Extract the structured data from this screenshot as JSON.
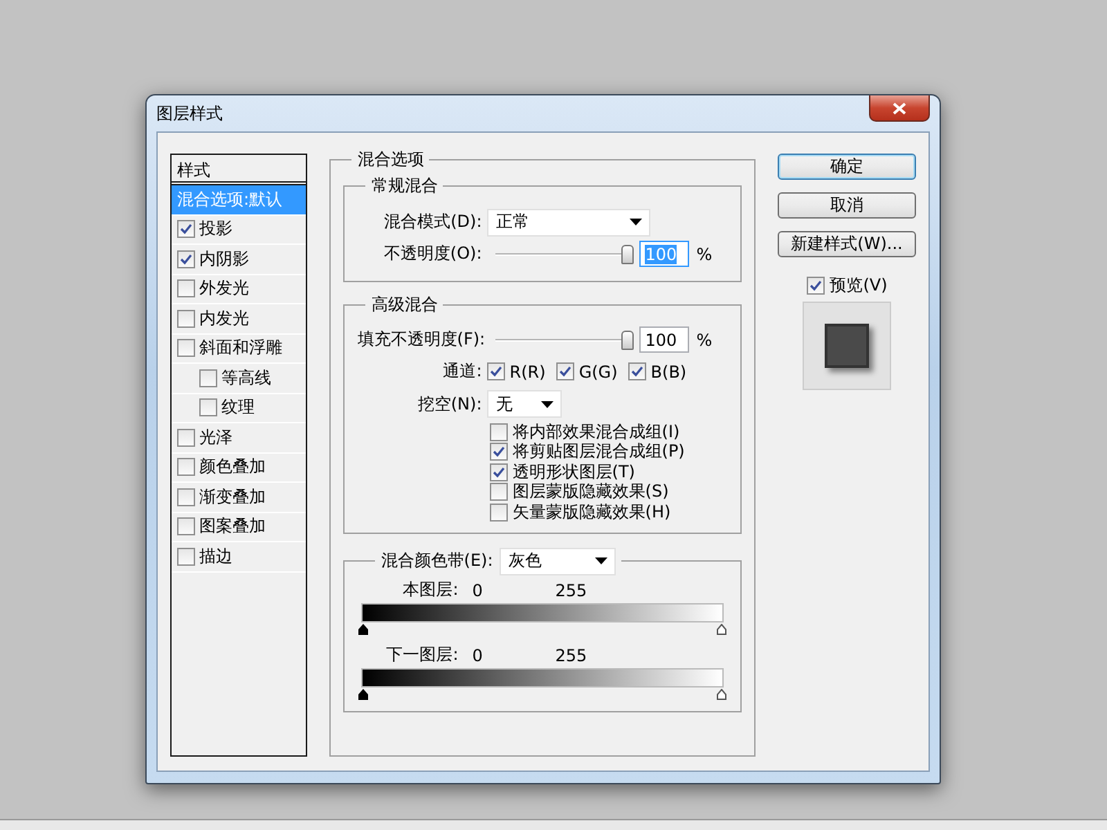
{
  "window": {
    "title": "图层样式"
  },
  "styles_list": {
    "header": "样式",
    "items": [
      {
        "kind": "plain",
        "label": "混合选项:默认",
        "selected": true
      },
      {
        "kind": "check",
        "label": "投影",
        "checked": true,
        "selected": false
      },
      {
        "kind": "check",
        "label": "内阴影",
        "checked": true,
        "selected": false
      },
      {
        "kind": "check",
        "label": "外发光",
        "checked": false,
        "selected": false
      },
      {
        "kind": "check",
        "label": "内发光",
        "checked": false,
        "selected": false
      },
      {
        "kind": "check",
        "label": "斜面和浮雕",
        "checked": false,
        "selected": false,
        "children": [
          {
            "kind": "check",
            "label": "等高线",
            "checked": false,
            "selected": false
          },
          {
            "kind": "check",
            "label": "纹理",
            "checked": false,
            "selected": false
          }
        ]
      },
      {
        "kind": "check",
        "label": "光泽",
        "checked": false,
        "selected": false
      },
      {
        "kind": "check",
        "label": "颜色叠加",
        "checked": false,
        "selected": false
      },
      {
        "kind": "check",
        "label": "渐变叠加",
        "checked": false,
        "selected": false
      },
      {
        "kind": "check",
        "label": "图案叠加",
        "checked": false,
        "selected": false
      },
      {
        "kind": "check",
        "label": "描边",
        "checked": false,
        "selected": false
      }
    ]
  },
  "blend_options": {
    "title": "混合选项",
    "general": {
      "title": "常规混合",
      "blend_mode": {
        "label": "混合模式(D):",
        "value": "正常"
      },
      "opacity": {
        "label": "不透明度(O):",
        "level": 1,
        "value": "100",
        "unit": "%",
        "selected": true
      }
    },
    "advanced": {
      "title": "高级混合",
      "fill_opacity": {
        "label": "填充不透明度(F):",
        "level": 1,
        "value": "100",
        "unit": "%",
        "selected": false
      },
      "channels": {
        "label": "通道:",
        "items": [
          {
            "label": "R(R)",
            "checked": true
          },
          {
            "label": "G(G)",
            "checked": true
          },
          {
            "label": "B(B)",
            "checked": true
          }
        ]
      },
      "knockout": {
        "label": "挖空(N):",
        "value": "无"
      },
      "options": [
        {
          "label": "将内部效果混合成组(I)",
          "checked": false
        },
        {
          "label": "将剪贴图层混合成组(P)",
          "checked": true
        },
        {
          "label": "透明形状图层(T)",
          "checked": true
        },
        {
          "label": "图层蒙版隐藏效果(S)",
          "checked": false
        },
        {
          "label": "矢量蒙版隐藏效果(H)",
          "checked": false
        }
      ]
    },
    "blend_if": {
      "label": "混合颜色带(E):",
      "value": "灰色",
      "bands": [
        {
          "label": "本图层:",
          "low": "0",
          "high": "255"
        },
        {
          "label": "下一图层:",
          "low": "0",
          "high": "255"
        }
      ]
    }
  },
  "buttons": [
    {
      "label": "确定",
      "default": true
    },
    {
      "label": "取消",
      "default": false
    },
    {
      "label": "新建样式(W)...",
      "default": false
    }
  ],
  "preview": {
    "label": "预览(V)",
    "checked": true
  }
}
